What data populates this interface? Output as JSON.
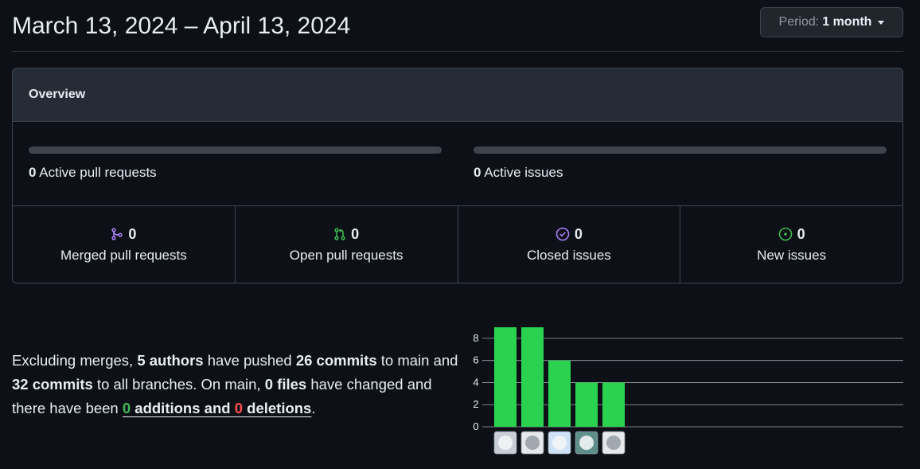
{
  "header": {
    "date_range": "March 13, 2024 – April 13, 2024",
    "period_label": "Period:",
    "period_value": "1 month"
  },
  "overview": {
    "title": "Overview",
    "active_pull_requests": {
      "count": "0",
      "label": "Active pull requests"
    },
    "active_issues": {
      "count": "0",
      "label": "Active issues"
    },
    "stats": [
      {
        "count": "0",
        "label": "Merged pull requests",
        "icon": "git-merge-icon",
        "color": "#ab7df8"
      },
      {
        "count": "0",
        "label": "Open pull requests",
        "icon": "git-pull-request-icon",
        "color": "#3fb950"
      },
      {
        "count": "0",
        "label": "Closed issues",
        "icon": "issue-closed-icon",
        "color": "#ab7df8"
      },
      {
        "count": "0",
        "label": "New issues",
        "icon": "issue-opened-icon",
        "color": "#3fb950"
      }
    ]
  },
  "summary": {
    "part1": "Excluding merges, ",
    "authors": "5 authors",
    "part2": " have pushed ",
    "commits_main": "26 commits",
    "part3": " to main and ",
    "commits_all": "32 commits",
    "part4": " to all branches. On main, ",
    "files": "0 files",
    "part5": " have changed and there have been ",
    "additions": "0",
    "additions_word": " additions",
    "and_word": " and ",
    "deletions": "0",
    "deletions_word": " deletions",
    "end": "."
  },
  "chart_data": {
    "type": "bar",
    "categories": [
      "author-1",
      "author-2",
      "author-3",
      "author-4",
      "author-5"
    ],
    "values": [
      9,
      9,
      6,
      4,
      4
    ],
    "ylim": [
      0,
      9
    ],
    "yticks": [
      "0",
      "2",
      "4",
      "6",
      "8"
    ],
    "bar_color": "#2ad250",
    "grid": true
  }
}
